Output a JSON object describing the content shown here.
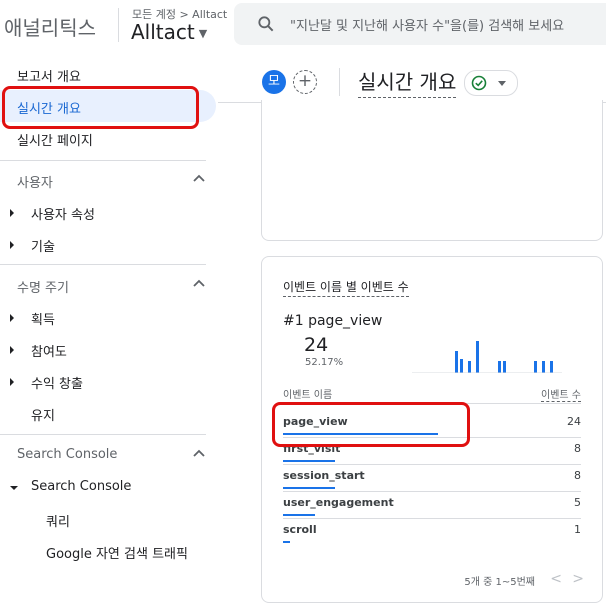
{
  "header": {
    "app_name": "애널리틱스",
    "breadcrumb": "모든 계정 > Alltact",
    "account_name": "Alltact",
    "search_placeholder": "\"지난달 및 지난해 사용자 수\"을(를) 검색해 보세요"
  },
  "sidebar": {
    "top_items": [
      {
        "label": "보고서 개요",
        "active": false
      },
      {
        "label": "실시간 개요",
        "active": true
      },
      {
        "label": "실시간 페이지",
        "active": false
      }
    ],
    "sections": [
      {
        "title": "사용자",
        "items": [
          "사용자 속성",
          "기술"
        ]
      },
      {
        "title": "수명 주기",
        "items": [
          "획득",
          "참여도",
          "수익 창출",
          "유지"
        ]
      },
      {
        "title": "Search Console",
        "group": "Search Console",
        "items": [
          "쿼리",
          "Google 자연 검색 트래픽"
        ]
      }
    ]
  },
  "main": {
    "avatar_letter": "모",
    "add_symbol": "+",
    "page_title": "실시간 개요",
    "status": "ok",
    "event_card": {
      "title": "이벤트 이름 별 이벤트 수",
      "top_rank": "#1",
      "top_event": "page_view",
      "top_count": "24",
      "top_percent": "52.17%",
      "col_name": "이벤트 이름",
      "col_count": "이벤트 수",
      "rows": [
        {
          "name": "page_view",
          "value": "24",
          "share": 1.0
        },
        {
          "name": "first_visit",
          "value": "8",
          "share": 0.333
        },
        {
          "name": "session_start",
          "value": "8",
          "share": 0.333
        },
        {
          "name": "user_engagement",
          "value": "5",
          "share": 0.208
        },
        {
          "name": "scroll",
          "value": "1",
          "share": 0.042
        }
      ],
      "pager_text": "5개 중 1~5번째",
      "prev_symbol": "<",
      "next_symbol": ">"
    }
  },
  "colors": {
    "accent": "#1a73e8",
    "active_bg": "#e8f0fe",
    "highlight": "#e01010",
    "ok_green": "#188038"
  }
}
